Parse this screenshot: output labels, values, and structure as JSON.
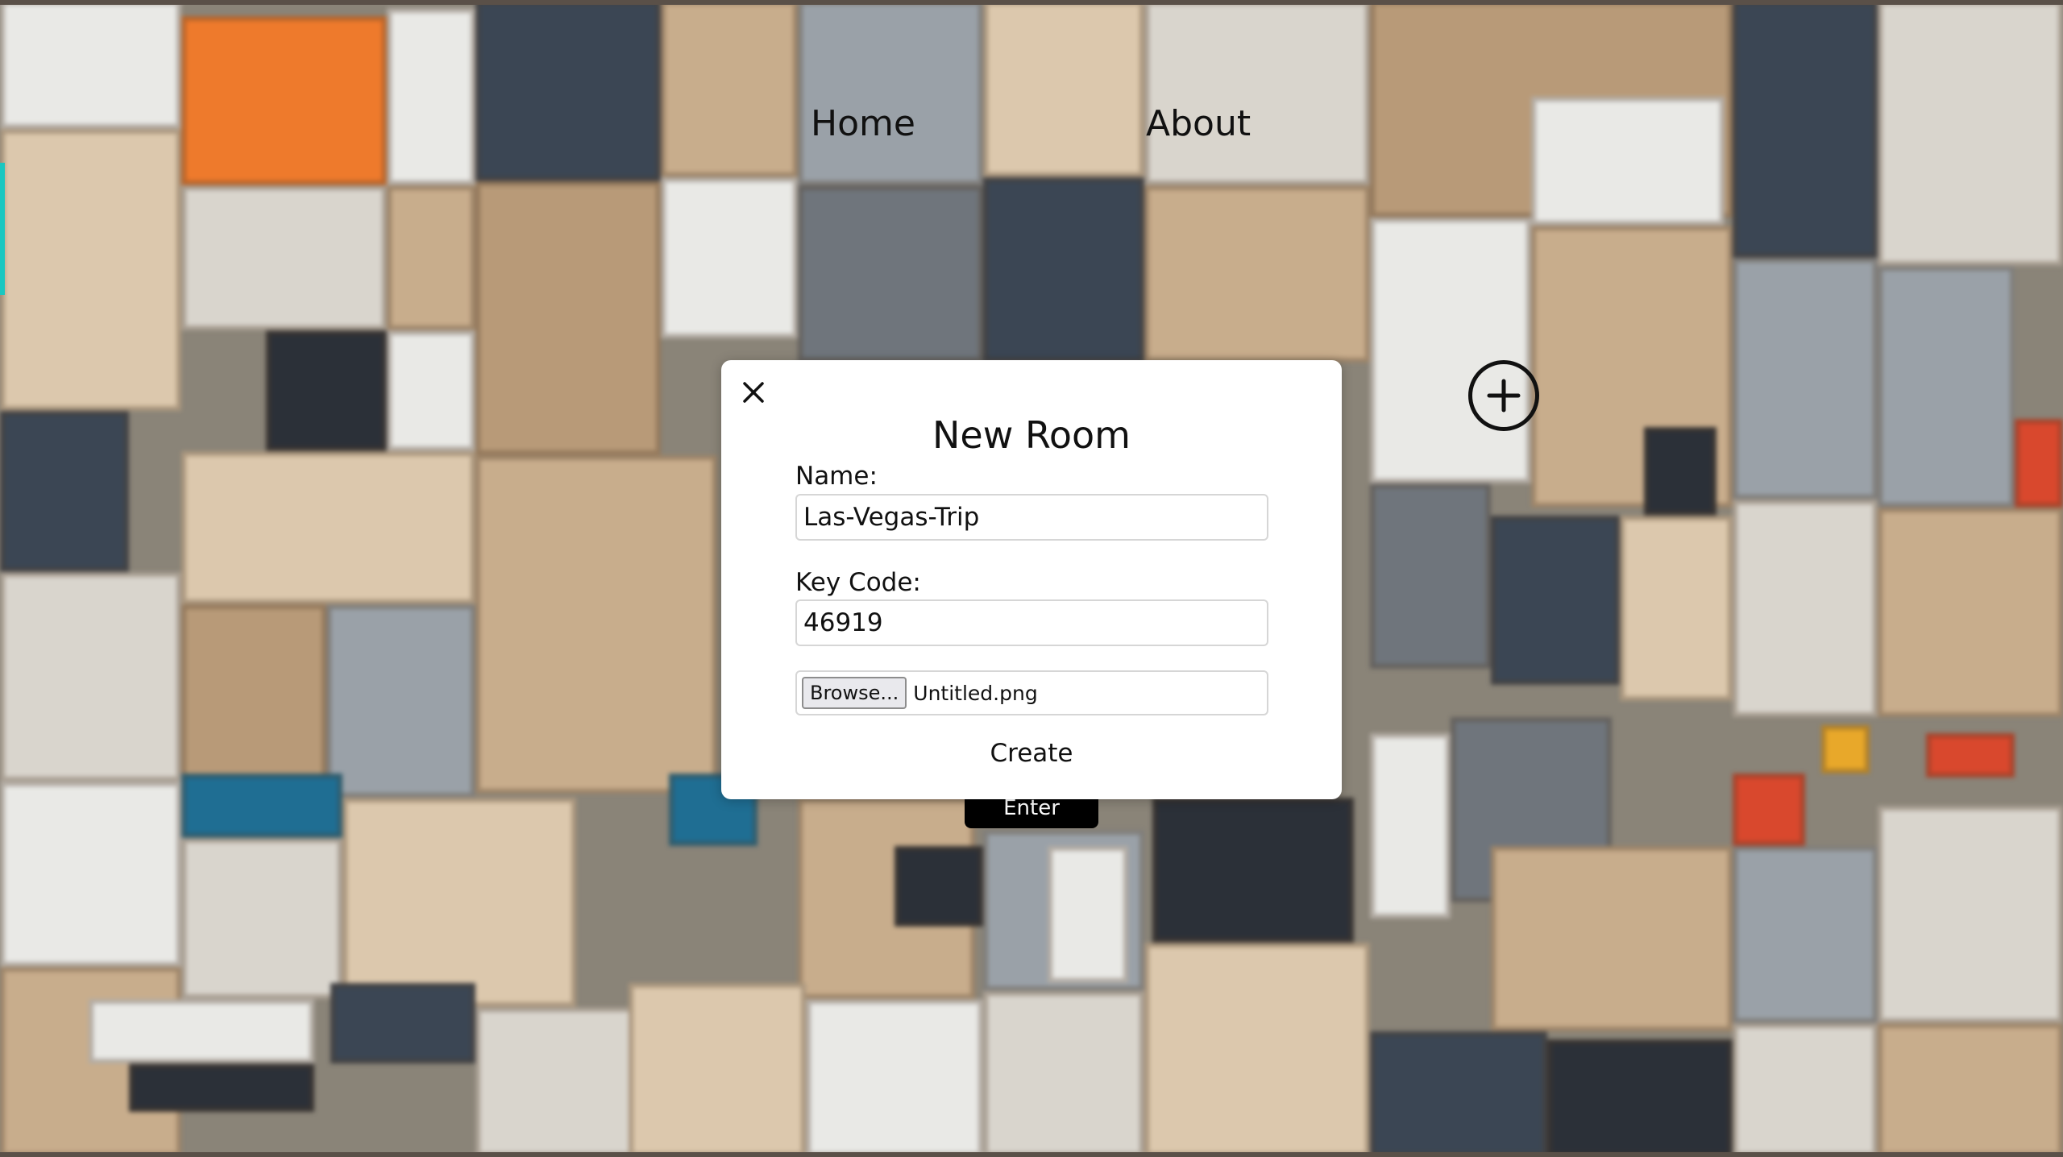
{
  "nav": {
    "home_label": "Home",
    "about_label": "About"
  },
  "enter_button_label": "Enter",
  "modal": {
    "title": "New Room",
    "name_label": "Name:",
    "name_value": "Las-Vegas-Trip",
    "key_label": "Key Code:",
    "key_value": "46919",
    "browse_label": "Browse...",
    "file_name": "Untitled.png",
    "create_label": "Create"
  },
  "icons": {
    "close": "close-icon",
    "add": "plus-circle-icon"
  },
  "colors": {
    "accent": "#19c7c0",
    "modal_bg": "#ffffff",
    "enter_bg": "#000000"
  }
}
